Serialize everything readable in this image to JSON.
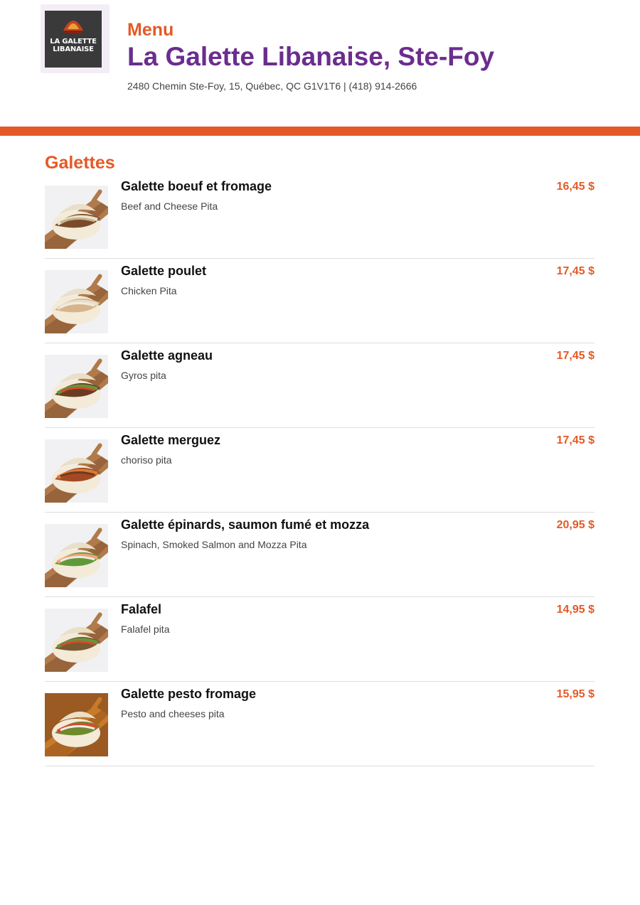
{
  "header": {
    "logo_text": "LA GALETTE LIBANAISE",
    "menu_label": "Menu",
    "restaurant_name": "La Galette Libanaise, Ste-Foy",
    "address": "2480 Chemin Ste-Foy, 15, Québec, QC G1V1T6 | (418) 914-2666"
  },
  "colors": {
    "accent": "#e35a27",
    "brand_purple": "#6b2d8e"
  },
  "section": {
    "title": "Galettes",
    "items": [
      {
        "name": "Galette boeuf et fromage",
        "description": "Beef and Cheese Pita",
        "price": "16,45 $"
      },
      {
        "name": "Galette poulet",
        "description": "Chicken Pita",
        "price": "17,45 $"
      },
      {
        "name": "Galette agneau",
        "description": "Gyros pita",
        "price": "17,45 $"
      },
      {
        "name": "Galette merguez",
        "description": "choriso pita",
        "price": "17,45 $"
      },
      {
        "name": "Galette épinards, saumon fumé et mozza",
        "description": "Spinach, Smoked Salmon and Mozza Pita",
        "price": "20,95 $"
      },
      {
        "name": "Falafel",
        "description": "Falafel pita",
        "price": "14,95 $"
      },
      {
        "name": "Galette pesto fromage",
        "description": "Pesto and cheeses pita",
        "price": "15,95 $"
      }
    ]
  }
}
